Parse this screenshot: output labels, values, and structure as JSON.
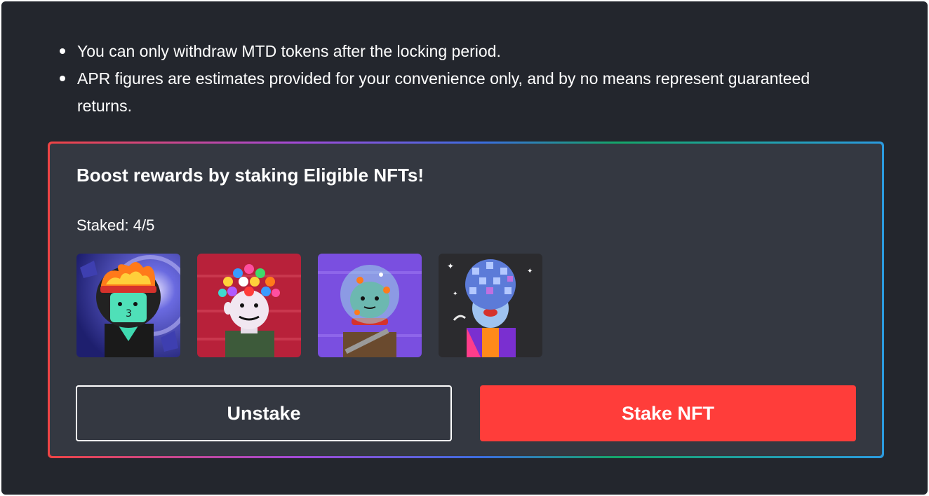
{
  "notes": [
    "You can only withdraw MTD tokens after the locking period.",
    "APR figures are estimates provided for your convenience only, and by no means represent guaranteed returns."
  ],
  "boost": {
    "title": "Boost rewards by staking Eligible NFTs!",
    "staked_text": "Staked: 4/5",
    "nfts": [
      {
        "name": "nft-astronaut-flame-helmet",
        "bg": "#2c2f8a"
      },
      {
        "name": "nft-gumball-hair",
        "bg": "#b8213a"
      },
      {
        "name": "nft-fishbowl-helmet",
        "bg": "#7a4fe0"
      },
      {
        "name": "nft-disco-ball-head",
        "bg": "#2b2b2e"
      }
    ],
    "unstake_label": "Unstake",
    "stake_label": "Stake NFT"
  },
  "colors": {
    "background": "#23262d",
    "card": "#343841",
    "accent": "#ff3d3a"
  }
}
